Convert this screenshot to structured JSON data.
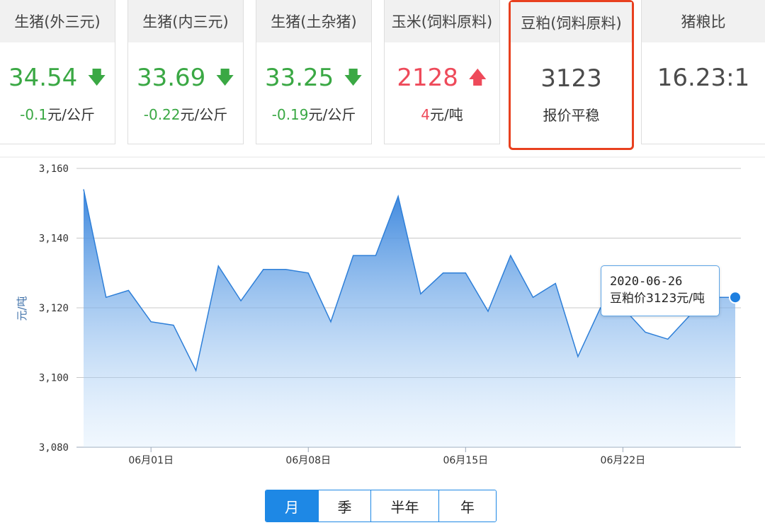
{
  "cards": [
    {
      "title": "生猪(外三元)",
      "value": "34.54",
      "change_num": "-0.1",
      "change_unit": "元/公斤",
      "trend": "down"
    },
    {
      "title": "生猪(内三元)",
      "value": "33.69",
      "change_num": "-0.22",
      "change_unit": "元/公斤",
      "trend": "down"
    },
    {
      "title": "生猪(土杂猪)",
      "value": "33.25",
      "change_num": "-0.19",
      "change_unit": "元/公斤",
      "trend": "down"
    },
    {
      "title": "玉米(饲料原料)",
      "value": "2128",
      "change_num": "4",
      "change_unit": "元/吨",
      "trend": "up"
    },
    {
      "title": "豆粕(饲料原料)",
      "value": "3123",
      "change_num": "",
      "change_unit": "报价平稳",
      "trend": "flat"
    },
    {
      "title": "猪粮比",
      "value": "16.23:1",
      "change_num": "",
      "change_unit": "",
      "trend": "none"
    }
  ],
  "icons": {
    "down": "arrow-down-icon",
    "up": "arrow-up-icon"
  },
  "colors": {
    "down": "#3aa844",
    "up": "#ee4a5a",
    "accent": "#1e88e5",
    "selected_border": "#e8401f"
  },
  "tooltip": {
    "date": "2020-06-26",
    "label": "豆粕价3123元/吨"
  },
  "range_buttons": {
    "month": "月",
    "quarter": "季",
    "half_year": "半年",
    "year": "年",
    "active": "月"
  },
  "chart_data": {
    "type": "area",
    "title": "",
    "ylabel": "元/吨",
    "xlabel": "",
    "ylim": [
      3080,
      3160
    ],
    "y_ticks": [
      "3,080",
      "3,100",
      "3,120",
      "3,140",
      "3,160"
    ],
    "y_tick_values": [
      3080,
      3100,
      3120,
      3140,
      3160
    ],
    "x_tick_labels": [
      "06月01日",
      "06月08日",
      "06月15日",
      "06月22日"
    ],
    "x_tick_dates": [
      "2020-05-31",
      "2020-06-07",
      "2020-06-14",
      "2020-06-21"
    ],
    "grid": true,
    "dates": [
      "2020-05-28",
      "2020-05-29",
      "2020-05-30",
      "2020-05-31",
      "2020-06-01",
      "2020-06-02",
      "2020-06-03",
      "2020-06-04",
      "2020-06-05",
      "2020-06-06",
      "2020-06-07",
      "2020-06-08",
      "2020-06-09",
      "2020-06-10",
      "2020-06-11",
      "2020-06-12",
      "2020-06-13",
      "2020-06-14",
      "2020-06-15",
      "2020-06-16",
      "2020-06-17",
      "2020-06-18",
      "2020-06-19",
      "2020-06-20",
      "2020-06-21",
      "2020-06-22",
      "2020-06-23",
      "2020-06-24",
      "2020-06-25",
      "2020-06-26"
    ],
    "values": [
      3154,
      3123,
      3125,
      3116,
      3115,
      3102,
      3132,
      3122,
      3131,
      3131,
      3130,
      3116,
      3135,
      3135,
      3152,
      3124,
      3130,
      3130,
      3119,
      3135,
      3123,
      3127,
      3106,
      3120,
      3120,
      3113,
      3111,
      3118,
      3123,
      3123
    ],
    "highlight": {
      "date": "2020-06-26",
      "value": 3123
    }
  }
}
